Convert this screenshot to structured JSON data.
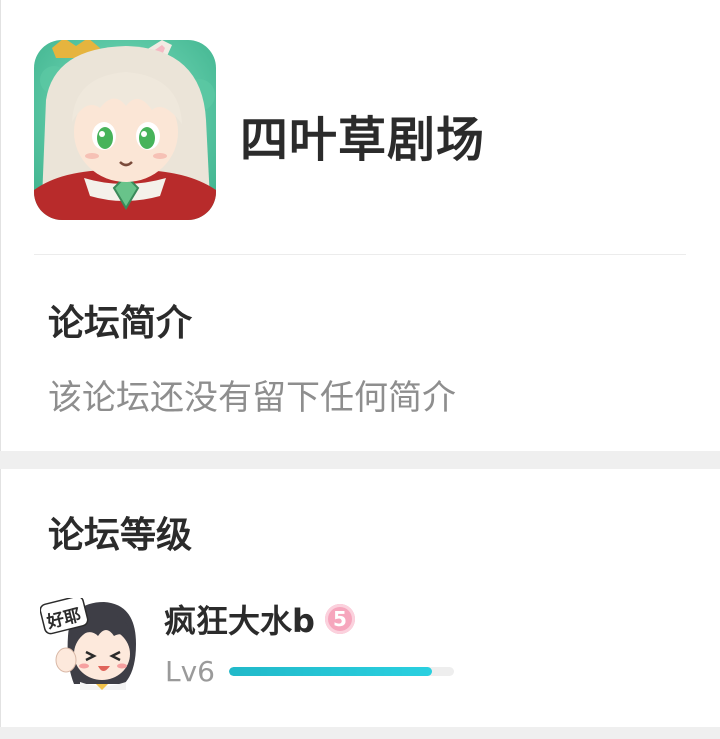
{
  "forum": {
    "name": "四叶草剧场",
    "avatar_icon": "anime-character-avatar"
  },
  "intro": {
    "title": "论坛简介",
    "text": "该论坛还没有留下任何简介"
  },
  "level_section": {
    "title": "论坛等级",
    "user": {
      "name": "疯狂大水b",
      "badge": "5",
      "badge_color": "#f6a6bd",
      "avatar_icon": "anime-user-avatar",
      "avatar_caption": "好耶",
      "level_label": "Lv6",
      "progress_percent": 90,
      "progress_color": "#21b9c9"
    }
  }
}
